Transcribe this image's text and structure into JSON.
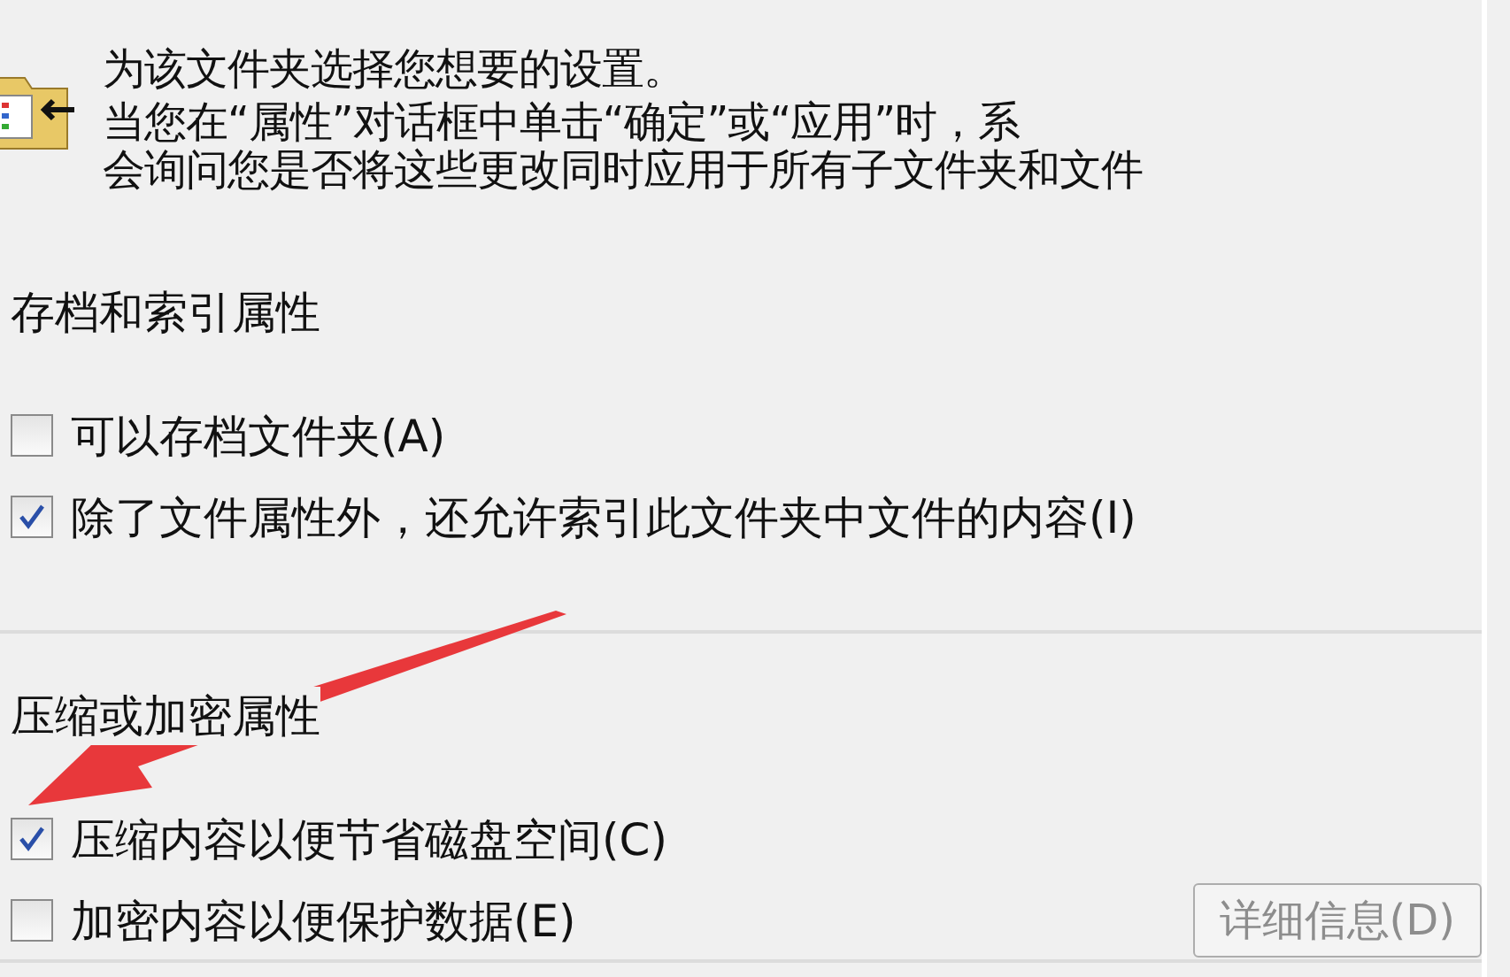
{
  "header": {
    "lines": [
      "为该文件夹选择您想要的设置。",
      "当您在“属性”对话框中单击“确定”或“应用”时，系",
      "会询问您是否将这些更改同时应用于所有子文件夹和文件"
    ]
  },
  "sections": [
    {
      "title": "存档和索引属性",
      "options": [
        {
          "label": "可以存档文件夹(A)",
          "checked": false
        },
        {
          "label": "除了文件属性外，还允许索引此文件夹中文件的内容(I)",
          "checked": true
        }
      ]
    },
    {
      "title": "压缩或加密属性",
      "options": [
        {
          "label": "压缩内容以便节省磁盘空间(C)",
          "checked": true
        },
        {
          "label": "加密内容以便保护数据(E)",
          "checked": false
        }
      ],
      "button": {
        "label": "详细信息(D)",
        "disabled": true
      }
    }
  ]
}
